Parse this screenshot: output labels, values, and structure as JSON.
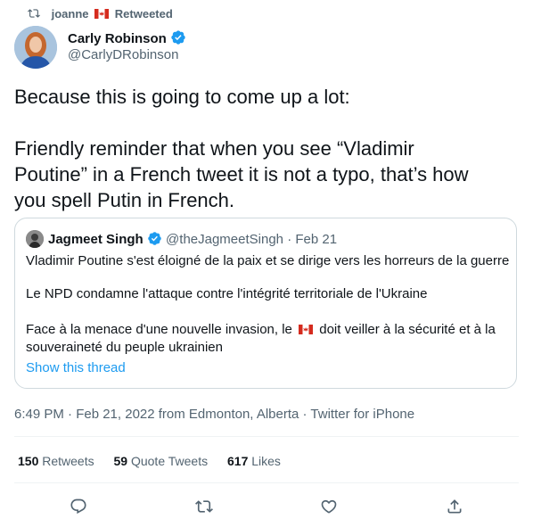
{
  "retweet": {
    "user": "joanne",
    "label": "Retweeted"
  },
  "author": {
    "name": "Carly Robinson",
    "handle": "@CarlyDRobinson"
  },
  "tweet": {
    "line1": "Because this is going to come up a lot:",
    "line2": "Friendly reminder that when you see “Vladimir",
    "line3": "Poutine” in a French tweet it is not a typo, that’s how",
    "line4": "you spell Putin in French."
  },
  "quoted": {
    "name": "Jagmeet Singh",
    "handle": "@theJagmeetSingh",
    "separator": "·",
    "date": "Feb 21",
    "p1": "Vladimir Poutine s'est éloigné de la paix et se dirige vers les horreurs de la guerre",
    "p2": "Le NPD condamne l'attaque contre l'intégrité territoriale de l'Ukraine",
    "p3a": "Face à la menace d'une nouvelle invasion, le",
    "p3b": "doit veiller à la sécurité et à la",
    "p3c": "souveraineté du peuple ukrainien",
    "show_thread": "Show this thread"
  },
  "meta": {
    "text": "6:49 PM · Feb 21, 2022 from Edmonton, Alberta · Twitter for iPhone"
  },
  "stats": {
    "retweets_count": "150",
    "retweets_label": "Retweets",
    "quotes_count": "59",
    "quotes_label": "Quote Tweets",
    "likes_count": "617",
    "likes_label": "Likes"
  },
  "colors": {
    "accent": "#1d9bf0",
    "text": "#0f1419",
    "muted": "#536471",
    "border": "#cfd9de"
  },
  "icons": [
    "retweet-icon",
    "canada-flag-icon",
    "verified-badge-icon",
    "reply-icon",
    "like-icon",
    "share-icon"
  ]
}
